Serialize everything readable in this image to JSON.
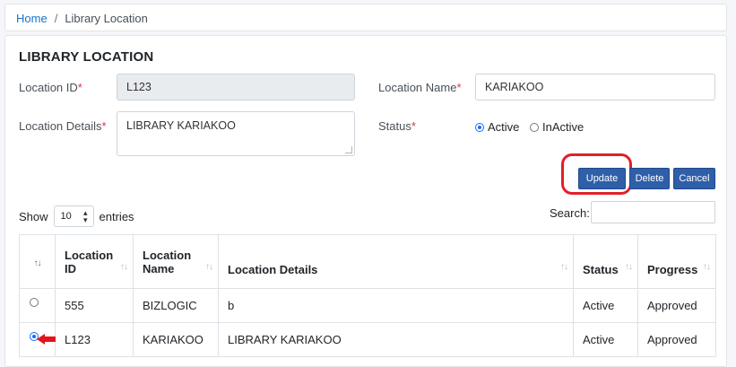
{
  "breadcrumb": {
    "home": "Home",
    "separator": "/",
    "current": "Library Location"
  },
  "form": {
    "title": "LIBRARY LOCATION",
    "location_id_label": "Location ID",
    "location_id_value": "L123",
    "location_name_label": "Location Name",
    "location_name_value": "KARIAKOO",
    "location_details_label": "Location Details",
    "location_details_value": "LIBRARY KARIAKOO",
    "status_label": "Status",
    "required_mark": "*",
    "status_options": [
      "Active",
      "InActive"
    ],
    "status_selected": "Active"
  },
  "buttons": {
    "update": "Update",
    "delete": "Delete",
    "cancel": "Cancel"
  },
  "table_controls": {
    "show_label": "Show",
    "entries_value": "10",
    "entries_label": "entries",
    "search_label": "Search:"
  },
  "table": {
    "headers": [
      "",
      "Location ID",
      "Location Name",
      "Location Details",
      "Status",
      "Progress"
    ],
    "rows": [
      {
        "selected": false,
        "id": "555",
        "name": "BIZLOGIC",
        "details": "b",
        "status": "Active",
        "progress": "Approved"
      },
      {
        "selected": true,
        "id": "L123",
        "name": "KARIAKOO",
        "details": "LIBRARY KARIAKOO",
        "status": "Active",
        "progress": "Approved"
      }
    ]
  },
  "colors": {
    "primary_button": "#2f5fa8",
    "highlight": "#e0202a",
    "link": "#1a73c8",
    "required": "#dc3545"
  }
}
